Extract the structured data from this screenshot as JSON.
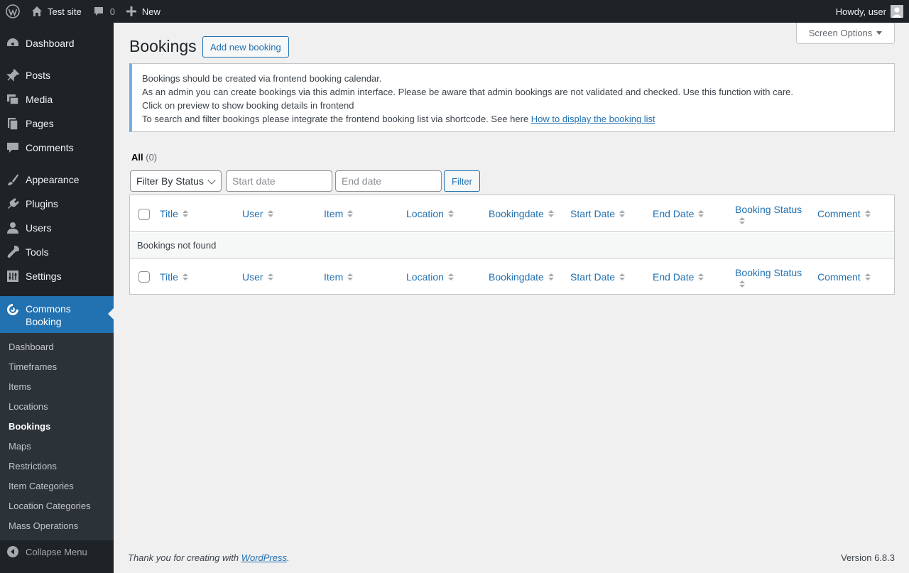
{
  "adminbar": {
    "site_name": "Test site",
    "comments_count": "0",
    "new_label": "New",
    "howdy": "Howdy, user"
  },
  "sidebar": {
    "items": [
      {
        "label": "Dashboard",
        "icon": "dashboard-icon"
      },
      {
        "label": "Posts",
        "icon": "pin-icon"
      },
      {
        "label": "Media",
        "icon": "media-icon"
      },
      {
        "label": "Pages",
        "icon": "pages-icon"
      },
      {
        "label": "Comments",
        "icon": "comment-icon"
      },
      {
        "label": "Appearance",
        "icon": "brush-icon"
      },
      {
        "label": "Plugins",
        "icon": "plug-icon"
      },
      {
        "label": "Users",
        "icon": "user-icon"
      },
      {
        "label": "Tools",
        "icon": "wrench-icon"
      },
      {
        "label": "Settings",
        "icon": "settings-icon"
      }
    ],
    "current": {
      "label_line1": "Commons",
      "label_line2": "Booking",
      "icon": "commons-booking-icon"
    },
    "submenu": [
      "Dashboard",
      "Timeframes",
      "Items",
      "Locations",
      "Bookings",
      "Maps",
      "Restrictions",
      "Item Categories",
      "Location Categories",
      "Mass Operations"
    ],
    "submenu_current": "Bookings",
    "collapse_label": "Collapse Menu"
  },
  "page": {
    "screen_options": "Screen Options",
    "title": "Bookings",
    "add_new": "Add new booking",
    "notice_lines": [
      "Bookings should be created via frontend booking calendar.",
      "As an admin you can create bookings via this admin interface. Please be aware that admin bookings are not validated and checked. Use this function with care.",
      "Click on preview to show booking details in frontend"
    ],
    "notice_last_text": "To search and filter bookings please integrate the frontend booking list via shortcode. See here ",
    "notice_link": "How to display the booking list",
    "views_all": "All",
    "views_count": "(0)",
    "filter_status": "Filter By Status",
    "start_date_placeholder": "Start date",
    "end_date_placeholder": "End date",
    "filter_button": "Filter",
    "columns": [
      "Title",
      "User",
      "Item",
      "Location",
      "Bookingdate",
      "Start Date",
      "End Date",
      "Booking Status",
      "Comment"
    ],
    "empty_message": "Bookings not found"
  },
  "footer": {
    "thanks_text": "Thank you for creating with ",
    "wp_link": "WordPress",
    "period": ".",
    "version": "Version 6.8.3"
  }
}
